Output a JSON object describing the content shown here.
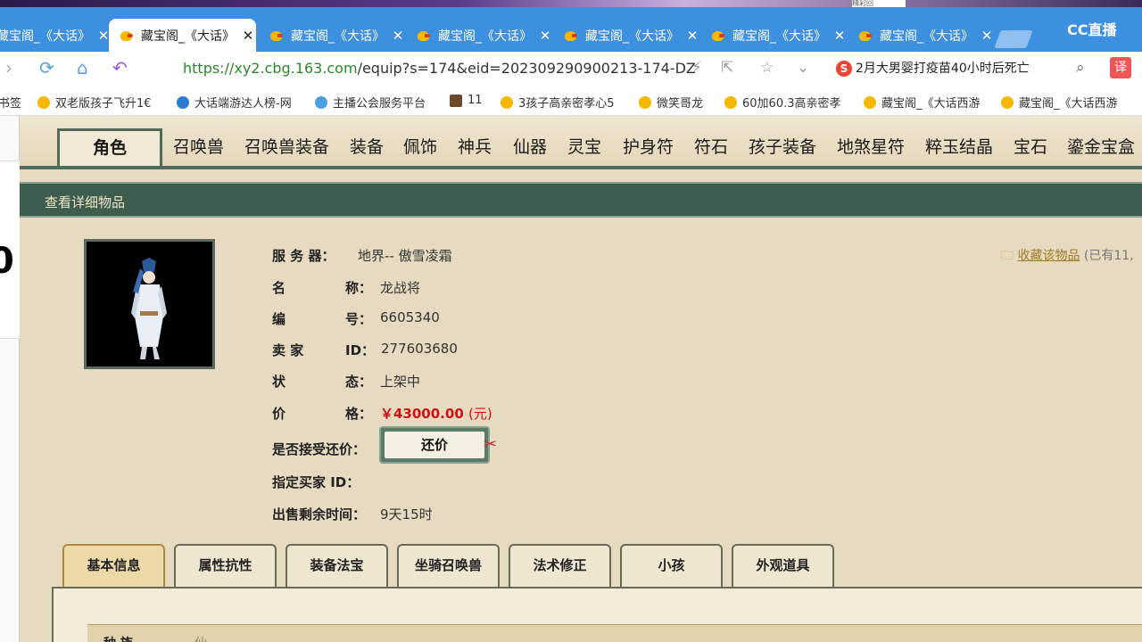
{
  "browser": {
    "top_snippet": "精彩回",
    "tabs": [
      {
        "title": "藏宝阁_《大话》",
        "active": false
      },
      {
        "title": "藏宝阁_《大话》",
        "active": true
      },
      {
        "title": "藏宝阁_《大话》",
        "active": false
      },
      {
        "title": "藏宝阁_《大话》",
        "active": false
      },
      {
        "title": "藏宝阁_《大话》",
        "active": false
      },
      {
        "title": "藏宝阁_《大话》",
        "active": false
      },
      {
        "title": "藏宝阁_《大话》",
        "active": false
      }
    ],
    "brand": "CC直播",
    "url_prefix": "https://",
    "url_host": "xy2.cbg.163.com",
    "url_path": "/equip?s=174&eid=202309290900213-174-DZ",
    "search_text": "2月大男婴打疫苗40小时后死亡",
    "translate_label": "译",
    "bookmarks": [
      {
        "label": "书签",
        "icon": "none"
      },
      {
        "label": "双老版孩子飞升1€",
        "icon": "chick"
      },
      {
        "label": "大话端游达人榜-网",
        "icon": "c"
      },
      {
        "label": "主播公会服务平台",
        "icon": "a"
      },
      {
        "label": "11",
        "icon": "g"
      },
      {
        "label": "3孩子高亲密孝心5",
        "icon": "chick"
      },
      {
        "label": "微笑哥龙",
        "icon": "chick"
      },
      {
        "label": "60加60.3高亲密孝",
        "icon": "chick"
      },
      {
        "label": "藏宝阁_《大话西游",
        "icon": "chick"
      },
      {
        "label": "藏宝阁_《大话西游",
        "icon": "chick"
      }
    ]
  },
  "nav": {
    "items": [
      "角色",
      "召唤兽",
      "召唤兽装备",
      "装备",
      "佩饰",
      "神兵",
      "仙器",
      "灵宝",
      "护身符",
      "符石",
      "孩子装备",
      "地煞星符",
      "粹玉结晶",
      "宝石",
      "鎏金宝盒"
    ]
  },
  "section_title": "查看详细物品",
  "item": {
    "server_label": "服 务 器：",
    "server_value": "地界-- 傲雪凌霜",
    "name_label_a": "名",
    "name_label_b": "称：",
    "name_value": "龙战将",
    "code_label_a": "编",
    "code_label_b": "号：",
    "code_value": "6605340",
    "seller_label_a": "卖 家",
    "seller_label_b": "ID：",
    "seller_value": "277603680",
    "status_label_a": "状",
    "status_label_b": "态：",
    "status_value": "上架中",
    "price_label_a": "价",
    "price_label_b": "格：",
    "price_value": "￥43000.00",
    "price_unit": "(元)",
    "bargain_label": "是否接受还价：",
    "bargain_button": "还价",
    "buyer_label": "指定买家 ID：",
    "remain_label": "出售剩余时间：",
    "remain_value": "9天15时"
  },
  "favorite": {
    "label": "收藏该物品",
    "count": "(已有11,"
  },
  "subtabs": [
    "基本信息",
    "属性抗性",
    "装备法宝",
    "坐骑召唤兽",
    "法术修正",
    "小孩",
    "外观道具"
  ],
  "detail": {
    "row_label": "种 族",
    "row_value": "仙"
  }
}
